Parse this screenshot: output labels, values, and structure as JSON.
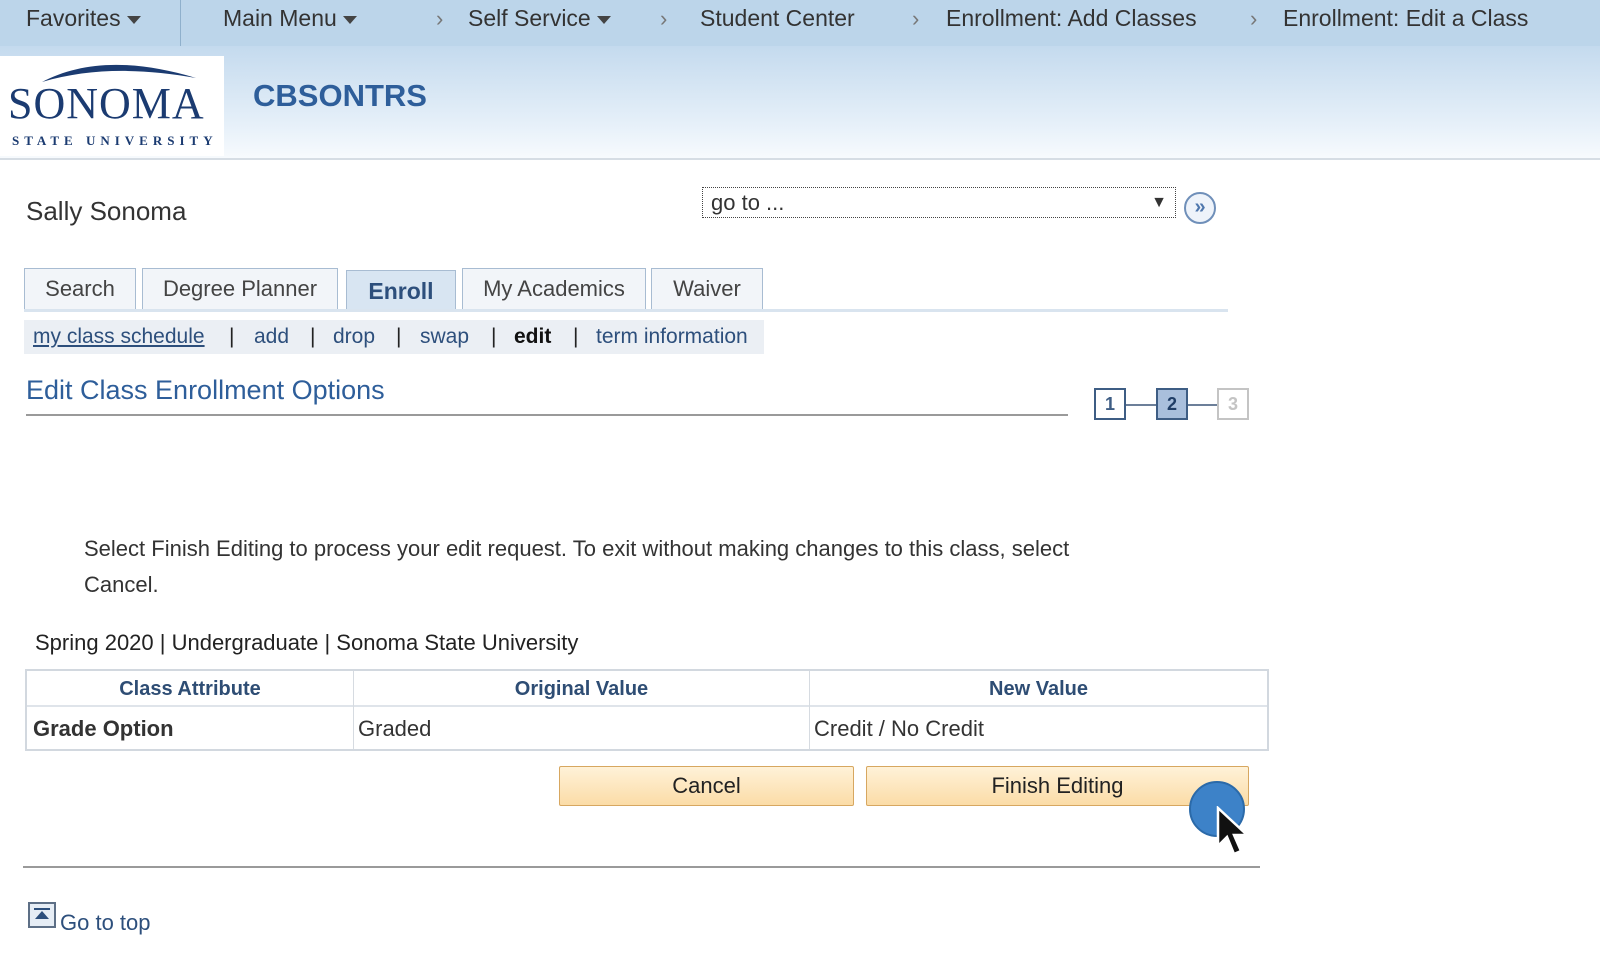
{
  "breadcrumb": {
    "favorites": "Favorites",
    "main_menu": "Main Menu",
    "self_service": "Self Service",
    "student_center": "Student Center",
    "add_classes": "Enrollment: Add Classes",
    "edit_class": "Enrollment: Edit a Class",
    "separator": "›"
  },
  "header": {
    "logo_word": "SONOMA",
    "logo_sub": "STATE UNIVERSITY",
    "app_title": "CBSONTRS"
  },
  "user": {
    "name": "Sally Sonoma"
  },
  "goto": {
    "value": "go to ...",
    "arrow": "▼",
    "go_symbol": "»"
  },
  "tabs": [
    {
      "label": "Search",
      "active": false
    },
    {
      "label": "Degree Planner",
      "active": false
    },
    {
      "label": "Enroll",
      "active": true
    },
    {
      "label": "My Academics",
      "active": false
    },
    {
      "label": "Waiver",
      "active": false
    }
  ],
  "subnav": {
    "items": [
      "my class schedule",
      "add",
      "drop",
      "swap",
      "edit",
      "term information"
    ],
    "current": "edit",
    "separator": "|"
  },
  "page": {
    "title": "Edit Class Enrollment Options",
    "steps": [
      "1",
      "2",
      "3"
    ],
    "current_step": 2,
    "instructions": "Select Finish Editing to process your edit request.  To exit without making changes to this class, select Cancel.",
    "term": "Spring 2020 | Undergraduate | Sonoma State University"
  },
  "table": {
    "headers": [
      "Class Attribute",
      "Original Value",
      "New Value"
    ],
    "rows": [
      [
        "Grade Option",
        "Graded",
        "Credit / No Credit"
      ]
    ]
  },
  "actions": {
    "cancel": "Cancel",
    "finish": "Finish Editing"
  },
  "footer": {
    "go_to_top": "Go to top"
  },
  "colors": {
    "accent": "#2e5e9a",
    "topbar": "#bcd5ea",
    "button": "#fbdca7",
    "cursor_highlight": "#3d82c8"
  }
}
